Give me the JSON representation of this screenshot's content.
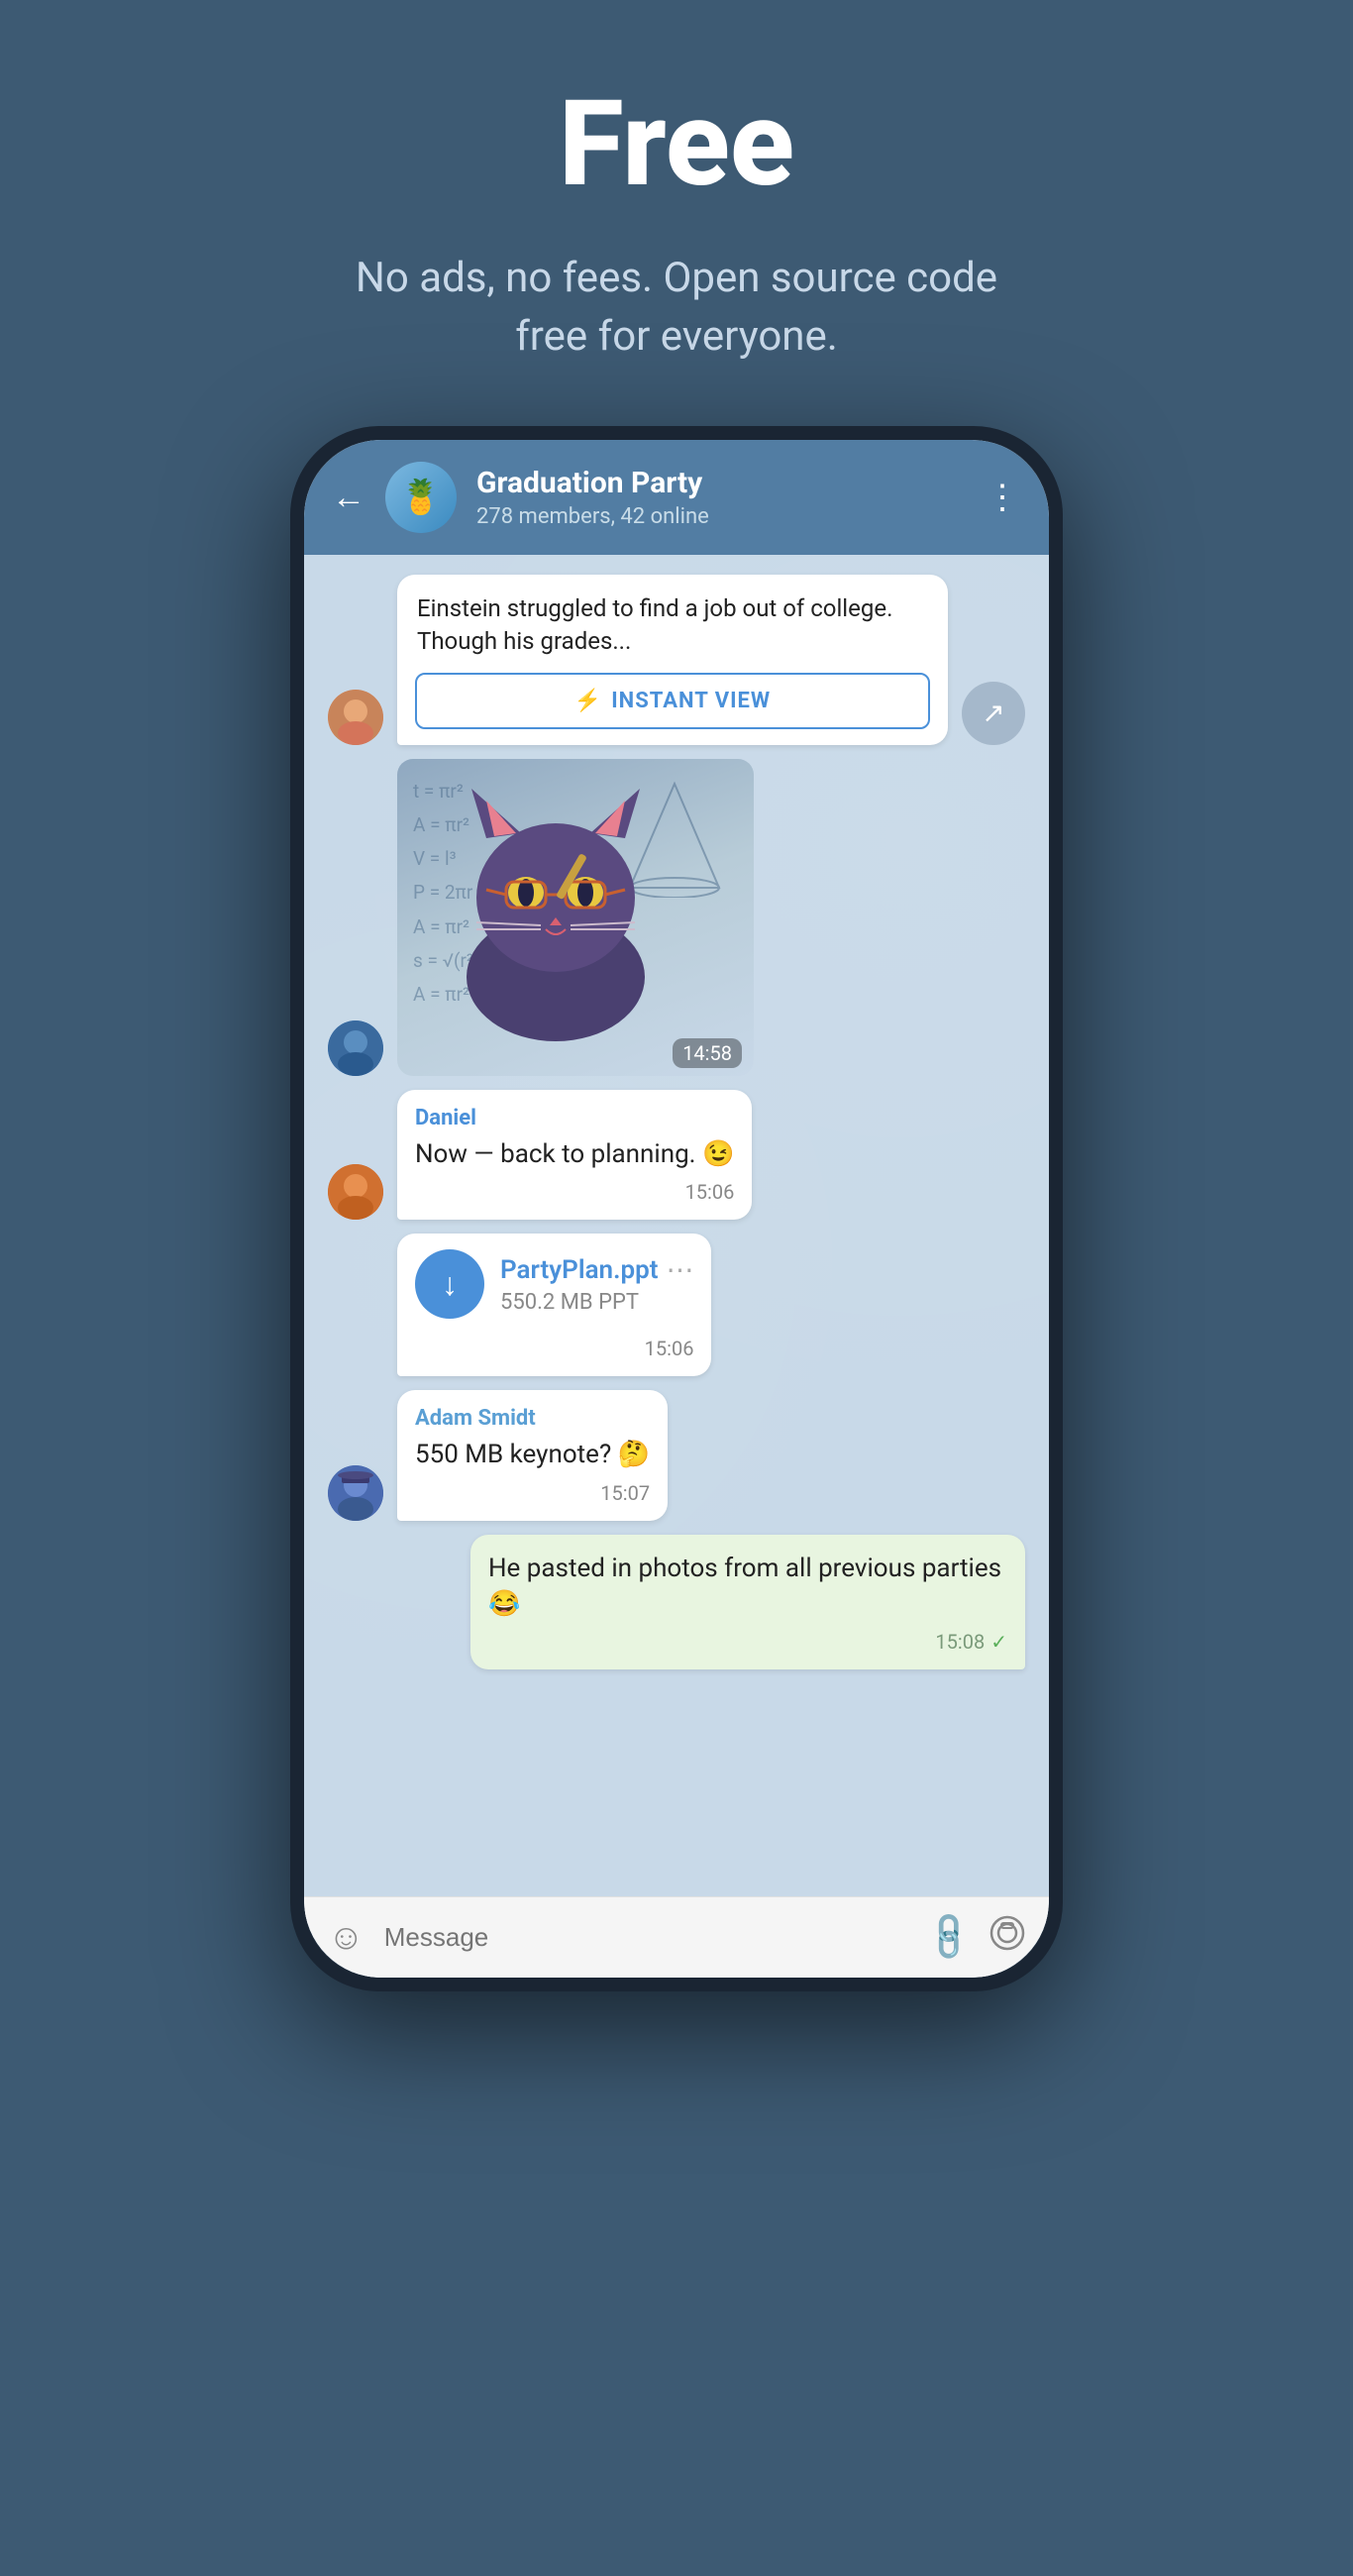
{
  "hero": {
    "title": "Free",
    "subtitle": "No ads, no fees. Open source code free for everyone."
  },
  "phone": {
    "header": {
      "group_name": "Graduation Party",
      "group_status": "278 members, 42 online",
      "group_emoji": "🍍",
      "back_label": "←",
      "more_label": "⋮"
    },
    "messages": [
      {
        "id": "article-msg",
        "type": "article",
        "avatar": "female",
        "article_text": "Einstein struggled to find a job out of college. Though his grades...",
        "iv_button_label": "INSTANT VIEW",
        "iv_icon": "⚡"
      },
      {
        "id": "sticker-msg",
        "type": "sticker",
        "avatar": "male1",
        "time": "14:58"
      },
      {
        "id": "daniel-msg",
        "type": "text",
        "avatar": "male2",
        "sender": "Daniel",
        "text": "Now — back to planning. 😉",
        "time": "15:06"
      },
      {
        "id": "file-msg",
        "type": "file",
        "avatar": "male2",
        "file_name": "PartyPlan.ppt",
        "file_size": "550.2 MB PPT",
        "time": "15:06"
      },
      {
        "id": "adam-msg",
        "type": "text",
        "avatar": "male3",
        "sender": "Adam Smidt",
        "sender_color": "adam",
        "text": "550 MB keynote? 🤔",
        "time": "15:07"
      },
      {
        "id": "self-msg",
        "type": "self",
        "text": "He pasted in photos from all previous parties 😂",
        "time": "15:08"
      }
    ],
    "input_bar": {
      "placeholder": "Message",
      "emoji_icon": "☺",
      "attach_icon": "📎",
      "camera_icon": "○"
    }
  }
}
